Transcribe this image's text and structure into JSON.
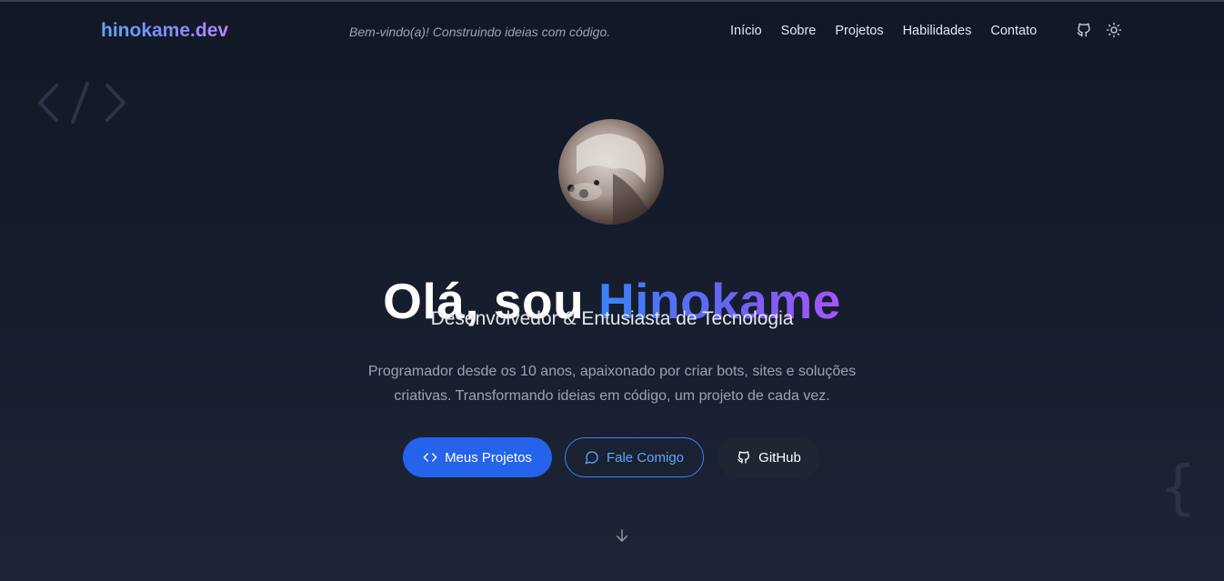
{
  "header": {
    "logo_main": "hinokame",
    "logo_suffix": ".dev",
    "tagline": "Bem-vindo(a)! Construindo ideias com código.",
    "nav": [
      "Início",
      "Sobre",
      "Projetos",
      "Habilidades",
      "Contato"
    ],
    "icons": [
      "github-icon",
      "sun-icon"
    ]
  },
  "hero": {
    "greeting": "Olá, sou",
    "name": "Hinokame",
    "subtitle": "Desenvolvedor & Entusiasta de Tecnologia",
    "description": "Programador desde os 10 anos, apaixonado por criar bots, sites e soluções criativas. Transformando ideias em código, um projeto de cada vez.",
    "buttons": {
      "projects": "Meus Projetos",
      "contact": "Fale Comigo",
      "github": "GitHub"
    }
  },
  "decorations": {
    "brace": "{"
  },
  "colors": {
    "primary": "#2563eb",
    "accent_blue": "#3b82f6",
    "accent_purple": "#a855f7",
    "background": "#151c2c"
  }
}
